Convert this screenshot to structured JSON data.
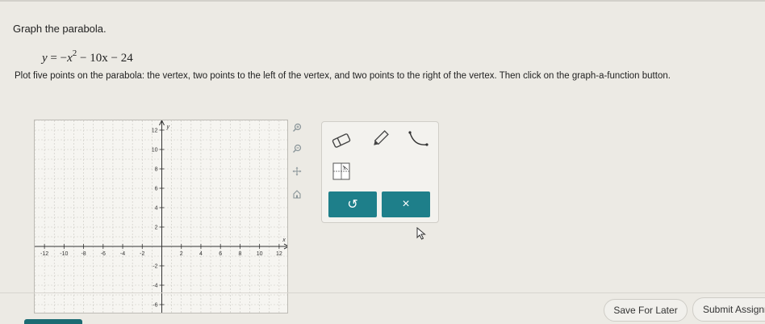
{
  "prompt": "Graph the parabola.",
  "equation": {
    "lhs": "y",
    "eq": "=",
    "minus": "−",
    "x": "x",
    "exp": "2",
    "rest": "− 10x − 24"
  },
  "instructions": "Plot five points on the parabola: the vertex, two points to the left of the vertex, and two points to the right of the vertex. Then click on the graph-a-function button.",
  "graph": {
    "x_axis_label": "x",
    "y_axis_label": "y",
    "x_ticks": [
      "-12",
      "-10",
      "-8",
      "-6",
      "-4",
      "-2",
      "2",
      "4",
      "6",
      "8",
      "10",
      "12"
    ],
    "y_ticks": [
      "12",
      "10",
      "8",
      "6",
      "4",
      "2",
      "-2",
      "-4",
      "-6"
    ],
    "x_range": [
      -13,
      13
    ],
    "y_range": [
      -7,
      13
    ]
  },
  "side_tools": [
    "zoom-in-icon",
    "zoom-out-icon",
    "pan-icon",
    "home-icon"
  ],
  "tools": [
    "eraser-icon",
    "pencil-icon",
    "parabola-icon",
    "graph-function-icon"
  ],
  "actions": {
    "undo_label": "↺",
    "clear_label": "×"
  },
  "footer": {
    "save_label": "Save For Later",
    "submit_label": "Submit Assignm"
  },
  "colors": {
    "accent": "#1e7f8a",
    "background": "#eceae4"
  }
}
